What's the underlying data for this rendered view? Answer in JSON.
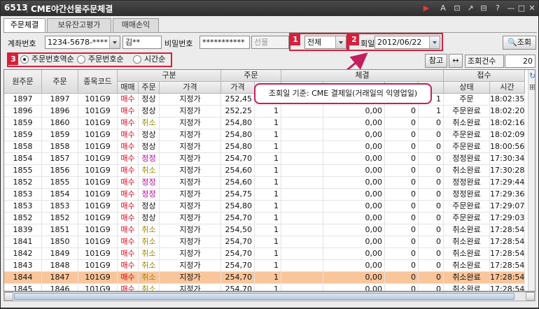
{
  "window": {
    "screen_no": "6513",
    "title": "CME야간선물주문체결",
    "controls": [
      "▶",
      "A",
      "⊡",
      "↗",
      "⊟",
      "?",
      "—",
      "□",
      "✕"
    ]
  },
  "tabs": [
    {
      "label": "주문체결",
      "active": true
    },
    {
      "label": "보유잔고평가",
      "active": false
    },
    {
      "label": "매매손익",
      "active": false
    }
  ],
  "form": {
    "account_label": "계좌번호",
    "account_value": "1234-5678-****",
    "name_value": "김**",
    "password_label": "비밀번호",
    "password_value": "***********",
    "futures_select": "선물",
    "badge1": "1",
    "filter_select": "전체",
    "badge2": "2",
    "query_date_label": "회일",
    "query_date_value": "2012/06/22",
    "query_button": "조회",
    "badge3": "3",
    "sort_options": [
      {
        "label": "주문번호역순",
        "checked": true
      },
      {
        "label": "주문번호순",
        "checked": false
      },
      {
        "label": "시간순",
        "checked": false
      }
    ],
    "ref_button": "참고",
    "arrow_button": "↔",
    "count_label": "조회건수",
    "count_value": "20"
  },
  "callout": {
    "text": "조회일 기준: CME 결제일(거래일의 익영업일)"
  },
  "grid": {
    "headers": {
      "orig_order": "원주문",
      "order": "주문",
      "item_code": "종목코드",
      "type_group": "구분",
      "side": "매매",
      "order_kind": "주문",
      "price_kind": "가격",
      "order_group": "주문",
      "order_price": "가격",
      "exec_group": "체결",
      "recv_group": "접수",
      "status": "상태",
      "time": "시간"
    },
    "rows": [
      {
        "orig": "1897",
        "ord": "1897",
        "code": "101G9",
        "side": "매수",
        "kind": "정상",
        "ptype": "지정가",
        "price": "252,45",
        "qty": "1",
        "e1": "",
        "e2": "0,00",
        "e3": "0",
        "e4": "1",
        "status": "주문",
        "time": "18:02:35",
        "kc": ""
      },
      {
        "orig": "1896",
        "ord": "1896",
        "code": "101G9",
        "side": "매수",
        "kind": "정상",
        "ptype": "지정가",
        "price": "252,25",
        "qty": "1",
        "e1": "",
        "e2": "0,00",
        "e3": "0",
        "e4": "1",
        "status": "주문완료",
        "time": "18:02:20",
        "kc": ""
      },
      {
        "orig": "1859",
        "ord": "1860",
        "code": "101G9",
        "side": "매수",
        "kind": "취소",
        "ptype": "지정가",
        "price": "254,80",
        "qty": "1",
        "e1": "",
        "e2": "0,00",
        "e3": "0",
        "e4": "0",
        "status": "취소완료",
        "time": "18:02:16",
        "kc": "olive"
      },
      {
        "orig": "1859",
        "ord": "1859",
        "code": "101G9",
        "side": "매수",
        "kind": "정상",
        "ptype": "지정가",
        "price": "254,80",
        "qty": "1",
        "e1": "",
        "e2": "0,00",
        "e3": "0",
        "e4": "0",
        "status": "주문완료",
        "time": "18:02:09",
        "kc": ""
      },
      {
        "orig": "1858",
        "ord": "1858",
        "code": "101G9",
        "side": "매수",
        "kind": "정상",
        "ptype": "지정가",
        "price": "254,80",
        "qty": "1",
        "e1": "",
        "e2": "0,00",
        "e3": "0",
        "e4": "0",
        "status": "주문완료",
        "time": "18:00:56",
        "kc": ""
      },
      {
        "orig": "1854",
        "ord": "1857",
        "code": "101G9",
        "side": "매수",
        "kind": "정정",
        "ptype": "지정가",
        "price": "254,70",
        "qty": "1",
        "e1": "",
        "e2": "0,00",
        "e3": "0",
        "e4": "0",
        "status": "정정완료",
        "time": "17:30:34",
        "kc": "mag"
      },
      {
        "orig": "1855",
        "ord": "1856",
        "code": "101G9",
        "side": "매수",
        "kind": "취소",
        "ptype": "지정가",
        "price": "254,60",
        "qty": "1",
        "e1": "",
        "e2": "0,00",
        "e3": "0",
        "e4": "0",
        "status": "취소완료",
        "time": "17:30:28",
        "kc": "olive"
      },
      {
        "orig": "1852",
        "ord": "1855",
        "code": "101G9",
        "side": "매수",
        "kind": "정정",
        "ptype": "지정가",
        "price": "254,60",
        "qty": "1",
        "e1": "",
        "e2": "0,00",
        "e3": "0",
        "e4": "0",
        "status": "정정완료",
        "time": "17:29:44",
        "kc": "mag"
      },
      {
        "orig": "1853",
        "ord": "1854",
        "code": "101G9",
        "side": "매수",
        "kind": "정정",
        "ptype": "지정가",
        "price": "254,75",
        "qty": "1",
        "e1": "",
        "e2": "0,00",
        "e3": "0",
        "e4": "0",
        "status": "정정완료",
        "time": "17:29:36",
        "kc": "mag"
      },
      {
        "orig": "1853",
        "ord": "1853",
        "code": "101G9",
        "side": "매수",
        "kind": "정상",
        "ptype": "지정가",
        "price": "254,80",
        "qty": "1",
        "e1": "",
        "e2": "0,00",
        "e3": "0",
        "e4": "0",
        "status": "주문완료",
        "time": "17:29:07",
        "kc": ""
      },
      {
        "orig": "1852",
        "ord": "1852",
        "code": "101G9",
        "side": "매수",
        "kind": "정상",
        "ptype": "지정가",
        "price": "254,70",
        "qty": "1",
        "e1": "",
        "e2": "0,00",
        "e3": "0",
        "e4": "0",
        "status": "주문완료",
        "time": "17:29:03",
        "kc": ""
      },
      {
        "orig": "1839",
        "ord": "1851",
        "code": "101G9",
        "side": "매수",
        "kind": "취소",
        "ptype": "지정가",
        "price": "254,50",
        "qty": "1",
        "e1": "",
        "e2": "0,00",
        "e3": "0",
        "e4": "0",
        "status": "취소완료",
        "time": "17:28:54",
        "kc": "olive"
      },
      {
        "orig": "1841",
        "ord": "1850",
        "code": "101G9",
        "side": "매수",
        "kind": "취소",
        "ptype": "지정가",
        "price": "254,70",
        "qty": "1",
        "e1": "",
        "e2": "0,00",
        "e3": "0",
        "e4": "0",
        "status": "취소완료",
        "time": "17:28:54",
        "kc": "olive"
      },
      {
        "orig": "1842",
        "ord": "1849",
        "code": "101G9",
        "side": "매수",
        "kind": "취소",
        "ptype": "지정가",
        "price": "254,70",
        "qty": "1",
        "e1": "",
        "e2": "0,00",
        "e3": "0",
        "e4": "0",
        "status": "취소완료",
        "time": "17:28:54",
        "kc": "olive"
      },
      {
        "orig": "1843",
        "ord": "1848",
        "code": "101G9",
        "side": "매수",
        "kind": "취소",
        "ptype": "지정가",
        "price": "254,70",
        "qty": "1",
        "e1": "",
        "e2": "0,00",
        "e3": "0",
        "e4": "0",
        "status": "취소완료",
        "time": "17:28:54",
        "kc": "olive"
      },
      {
        "orig": "1844",
        "ord": "1847",
        "code": "101G9",
        "side": "매수",
        "kind": "취소",
        "ptype": "지정가",
        "price": "254,70",
        "qty": "1",
        "e1": "",
        "e2": "0,00",
        "e3": "0",
        "e4": "0",
        "status": "취소완료",
        "time": "17:28:54",
        "kc": "olive",
        "selected": true
      },
      {
        "orig": "1845",
        "ord": "1846",
        "code": "101G9",
        "side": "매수",
        "kind": "취소",
        "ptype": "지정가",
        "price": "254,70",
        "qty": "1",
        "e1": "",
        "e2": "0,00",
        "e3": "0",
        "e4": "0",
        "status": "취소완료",
        "time": "17:28:54",
        "kc": "olive"
      }
    ]
  },
  "colors": {
    "buy": "#e0001a",
    "cancel": "#9a8a00",
    "modify": "#c000a0",
    "selected_row": "#f9c59a",
    "annotation": "#d6203b",
    "callout_border": "#c41f5c"
  }
}
